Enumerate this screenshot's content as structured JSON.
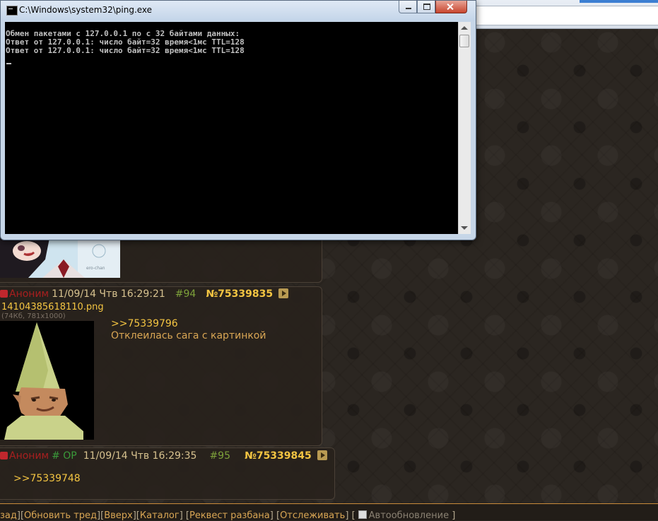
{
  "cmd": {
    "title": "C:\\Windows\\system32\\ping.exe",
    "lines": [
      "Обмен пакетами с 127.0.0.1 по с 32 байтами данных:",
      "Ответ от 127.0.0.1: число байт=32 время<1мс TTL=128",
      "Ответ от 127.0.0.1: число байт=32 время<1мс TTL=128"
    ]
  },
  "posts": [
    {
      "name": "Аноним",
      "date": "11/09/14 Чтв 16:29:21",
      "index": "#94",
      "number": "№75339835",
      "file_name": "14104385618110.png",
      "file_meta": "(74Кб, 781x1000)",
      "reply": ">>75339796",
      "text": "Отклеилась сага с картинкой"
    },
    {
      "name": "Аноним",
      "op": "# OP",
      "date": "11/09/14 Чтв 16:29:35",
      "index": "#95",
      "number": "№75339845",
      "reply": ">>75339748"
    }
  ],
  "bottom_nav": {
    "back": "зад",
    "refresh": "Обновить тред",
    "up": "Вверх",
    "catalog": "Каталог",
    "ban_request": "Реквест разбана",
    "watch": "Отслеживать",
    "auto_update": "Автообновление"
  },
  "colors": {
    "post_name": "#a81f1f",
    "post_number": "#f4c542",
    "post_text": "#d9a654",
    "console_bg": "#000000"
  }
}
